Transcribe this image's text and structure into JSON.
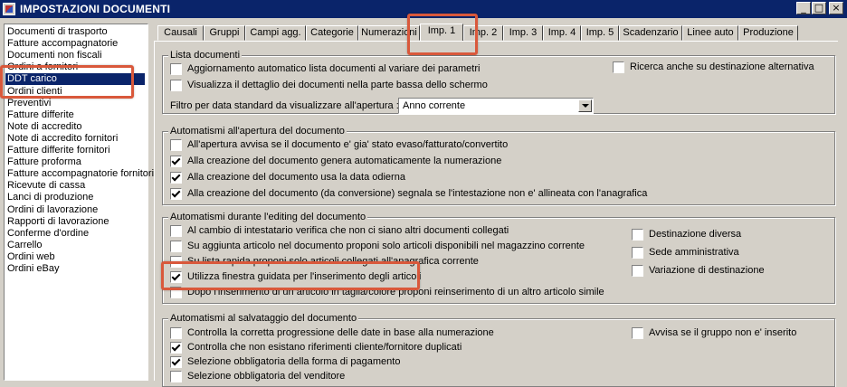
{
  "window": {
    "title": "IMPOSTAZIONI DOCUMENTI",
    "minimize": "_",
    "maximize": "□",
    "close": "×"
  },
  "sidebar": {
    "items": [
      "Documenti di trasporto",
      "Fatture accompagnatorie",
      "Documenti non fiscali",
      "Ordini a fornitori",
      "DDT carico",
      "Ordini clienti",
      "Preventivi",
      "Fatture differite",
      "Note di accredito",
      "Note di accredito fornitori",
      "Fatture differite fornitori",
      "Fatture proforma",
      "Fatture accompagnatorie fornitori",
      "Ricevute di cassa",
      "Lanci di produzione",
      "Ordini di lavorazione",
      "Rapporti di lavorazione",
      "Conferme d'ordine",
      "Carrello",
      "Ordini web",
      "Ordini eBay"
    ],
    "selected_index": 4
  },
  "tabs": [
    "Causali",
    "Gruppi",
    "Campi agg.",
    "Categorie",
    "Numerazioni",
    "Imp. 1",
    "Imp. 2",
    "Imp. 3",
    "Imp. 4",
    "Imp. 5",
    "Scadenzario",
    "Linee auto",
    "Produzione"
  ],
  "active_tab": "Imp. 1",
  "lista": {
    "title": "Lista documenti",
    "aggiornamento": {
      "label": "Aggiornamento automatico lista documenti al variare dei parametri",
      "checked": false
    },
    "visualizza": {
      "label": "Visualizza il dettaglio dei documenti nella parte bassa dello schermo",
      "checked": false
    },
    "ricerca": {
      "label": "Ricerca anche su destinazione alternativa",
      "checked": false
    },
    "filtro_label": "Filtro per data standard da visualizzare all'apertura :",
    "filtro_value": "Anno corrente"
  },
  "apertura": {
    "title": "Automatismi all'apertura del documento",
    "items": [
      {
        "label": "All'apertura avvisa se il documento e' gia' stato evaso/fatturato/convertito",
        "checked": false
      },
      {
        "label": "Alla creazione del documento genera automaticamente la numerazione",
        "checked": true
      },
      {
        "label": "Alla creazione del documento usa la data odierna",
        "checked": true
      },
      {
        "label": "Alla creazione del documento (da conversione) segnala se l'intestazione non e' allineata con l'anagrafica",
        "checked": true
      }
    ]
  },
  "editing": {
    "title": "Automatismi durante l'editing del documento",
    "items": [
      {
        "label": "Al cambio di intestatario verifica che non ci siano altri documenti collegati",
        "checked": false
      },
      {
        "label": "Su aggiunta articolo nel documento proponi solo articoli disponibili nel magazzino corrente",
        "checked": false
      },
      {
        "label": "Su lista rapida proponi solo articoli collegati all'anagrafica corrente",
        "checked": false
      },
      {
        "label": "Utilizza finestra guidata per l'inserimento degli articoli",
        "checked": true
      },
      {
        "label": "Dopo l'inserimento di un articolo in taglia/colore proponi reinserimento di un altro articolo simile",
        "checked": false
      }
    ],
    "right": [
      {
        "label": "Destinazione diversa",
        "checked": false
      },
      {
        "label": "Sede amministrativa",
        "checked": false
      },
      {
        "label": "Variazione di destinazione",
        "checked": false
      }
    ]
  },
  "salvataggio": {
    "title": "Automatismi al salvataggio del documento",
    "items": [
      {
        "label": "Controlla la corretta progressione delle date in base alla numerazione",
        "checked": false
      },
      {
        "label": "Controlla che non esistano riferimenti cliente/fornitore duplicati",
        "checked": true
      },
      {
        "label": "Selezione obbligatoria della forma di pagamento",
        "checked": true
      },
      {
        "label": "Selezione obbligatoria del venditore",
        "checked": false
      }
    ],
    "avvisa": {
      "label": "Avvisa se il gruppo non e' inserito",
      "checked": false
    }
  },
  "colors": {
    "titlebar": "#0a246a",
    "highlight": "#d9583b",
    "face": "#d4d0c8"
  }
}
